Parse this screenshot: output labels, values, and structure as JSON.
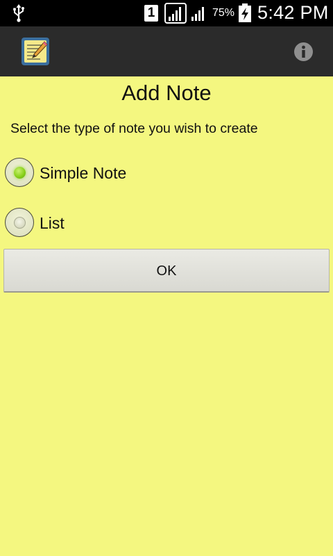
{
  "status_bar": {
    "sim_slot": "1",
    "battery_percent": "75%",
    "time": "5:42 PM",
    "icons": [
      "usb-icon",
      "signal-icon",
      "signal-icon",
      "battery-charging-icon"
    ]
  },
  "action_bar": {
    "app_icon": "notepad-pencil-icon",
    "info_icon": "info-icon"
  },
  "main": {
    "title": "Add Note",
    "instructions": "Select the type of note you wish to create",
    "options": [
      {
        "label": "Simple Note",
        "selected": true
      },
      {
        "label": "List",
        "selected": false
      }
    ],
    "ok_label": "OK"
  },
  "colors": {
    "background": "#f4f780",
    "action_bar": "#2b2b2b",
    "status_bar": "#000000",
    "selected_radio": "#8bd21c"
  }
}
